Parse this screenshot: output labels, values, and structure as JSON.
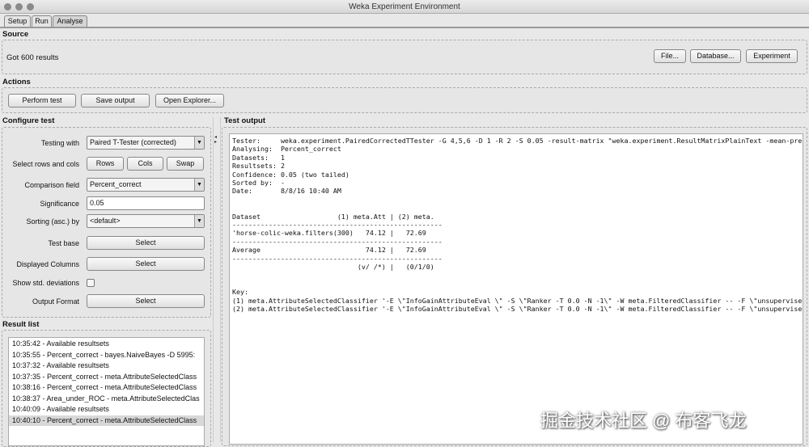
{
  "window": {
    "title": "Weka Experiment Environment"
  },
  "tabs": [
    {
      "label": "Setup"
    },
    {
      "label": "Run"
    },
    {
      "label": "Analyse"
    }
  ],
  "source": {
    "label": "Source",
    "status": "Got 600 results",
    "buttons": {
      "file": "File...",
      "database": "Database...",
      "experiment": "Experiment"
    }
  },
  "actions": {
    "label": "Actions",
    "buttons": {
      "perform": "Perform test",
      "save": "Save output",
      "explorer": "Open Explorer..."
    }
  },
  "configure": {
    "label": "Configure test",
    "testing_with": {
      "label": "Testing with",
      "value": "Paired T-Tester (corrected)"
    },
    "rows_cols": {
      "label": "Select rows and cols",
      "rows": "Rows",
      "cols": "Cols",
      "swap": "Swap"
    },
    "comparison": {
      "label": "Comparison field",
      "value": "Percent_correct"
    },
    "significance": {
      "label": "Significance",
      "value": "0.05"
    },
    "sorting": {
      "label": "Sorting (asc.) by",
      "value": "<default>"
    },
    "test_base": {
      "label": "Test base",
      "button": "Select"
    },
    "displayed": {
      "label": "Displayed Columns",
      "button": "Select"
    },
    "std": {
      "label": "Show std. deviations",
      "checked": false
    },
    "output_format": {
      "label": "Output Format",
      "button": "Select"
    }
  },
  "result_list": {
    "label": "Result list",
    "items": [
      "10:35:42 - Available resultsets",
      "10:35:55 - Percent_correct - bayes.NaiveBayes -D 5995:",
      "10:37:32 - Available resultsets",
      "10:37:35 - Percent_correct - meta.AttributeSelectedClass",
      "10:38:16 - Percent_correct - meta.AttributeSelectedClass",
      "10:38:37 - Area_under_ROC - meta.AttributeSelectedClas",
      "10:40:09 - Available resultsets",
      "10:40:10 - Percent_correct - meta.AttributeSelectedClass"
    ],
    "selected_index": 7
  },
  "test_output": {
    "label": "Test output",
    "text": "Tester:     weka.experiment.PairedCorrectedTTester -G 4,5,6 -D 1 -R 2 -S 0.05 -result-matrix \"weka.experiment.ResultMatrixPlainText -mean-prec\nAnalysing:  Percent_correct\nDatasets:   1\nResultsets: 2\nConfidence: 0.05 (two tailed)\nSorted by:  -\nDate:       8/8/16 10:40 AM\n\n\nDataset                   (1) meta.Att | (2) meta.\n----------------------------------------------------\n'horse-colic-weka.filters(300)   74.12 |   72.69\n----------------------------------------------------\nAverage                          74.12 |   72.69\n----------------------------------------------------\n                               (v/ /*) |   (0/1/0)\n\n\nKey:\n(1) meta.AttributeSelectedClassifier '-E \\\"InfoGainAttributeEval \\\" -S \\\"Ranker -T 0.0 -N -1\\\" -W meta.FilteredClassifier -- -F \\\"unsupervised\n(2) meta.AttributeSelectedClassifier '-E \\\"InfoGainAttributeEval \\\" -S \\\"Ranker -T 0.0 -N -1\\\" -W meta.FilteredClassifier -- -F \\\"unsupervised"
  },
  "watermark": "掘金技术社区 @ 布客飞龙"
}
